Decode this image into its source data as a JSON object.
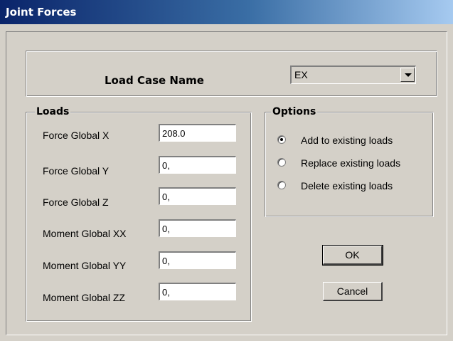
{
  "window": {
    "title": "Joint Forces"
  },
  "load_case": {
    "label": "Load Case Name",
    "selected": "EX"
  },
  "loads": {
    "group_label": "Loads",
    "fields": [
      {
        "label": "Force Global X",
        "value": "208.0"
      },
      {
        "label": "Force Global Y",
        "value": "0,"
      },
      {
        "label": "Force Global Z",
        "value": "0,"
      },
      {
        "label": "Moment Global XX",
        "value": "0,"
      },
      {
        "label": "Moment Global YY",
        "value": "0,"
      },
      {
        "label": "Moment Global ZZ",
        "value": "0,"
      }
    ]
  },
  "options": {
    "group_label": "Options",
    "items": [
      {
        "label": "Add to existing loads",
        "checked": true
      },
      {
        "label": "Replace existing loads",
        "checked": false
      },
      {
        "label": "Delete existing loads",
        "checked": false
      }
    ]
  },
  "buttons": {
    "ok": "OK",
    "cancel": "Cancel"
  }
}
